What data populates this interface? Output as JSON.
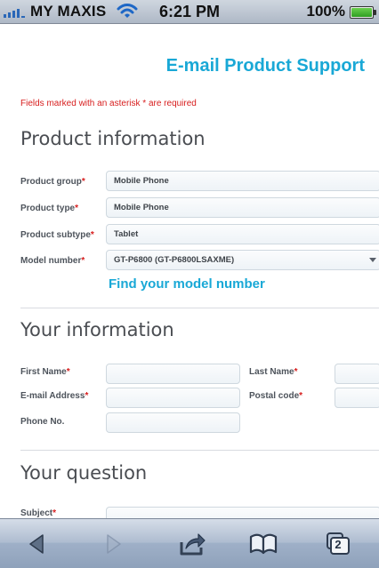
{
  "status_bar": {
    "carrier": "MY MAXIS",
    "time": "6:21 PM",
    "battery": "100%",
    "battery_level": 1.0
  },
  "page": {
    "title": "E-mail Product Support",
    "required_note": "Fields marked with an asterisk * are required"
  },
  "product_section": {
    "heading": "Product information",
    "fields": [
      {
        "label": "Product group",
        "required": true,
        "value": "Mobile Phone"
      },
      {
        "label": "Product type",
        "required": true,
        "value": "Mobile Phone"
      },
      {
        "label": "Product subtype",
        "required": true,
        "value": "Tablet"
      },
      {
        "label": "Model number",
        "required": true,
        "value": "GT-P6800 (GT-P6800LSAXME)"
      }
    ],
    "find_model_link": "Find your model number"
  },
  "your_information": {
    "heading": "Your information",
    "fields": [
      {
        "label": "First Name",
        "required": true,
        "value": ""
      },
      {
        "label": "Last Name",
        "required": true,
        "value": ""
      },
      {
        "label": "E-mail Address",
        "required": true,
        "value": ""
      },
      {
        "label": "Postal code",
        "required": true,
        "value": ""
      },
      {
        "label": "Phone No.",
        "required": false,
        "value": ""
      }
    ]
  },
  "your_question": {
    "heading": "Your question",
    "subject_label": "Subject",
    "subject_required": true
  },
  "toolbar": {
    "tabs_count": "2",
    "icons": [
      "back-icon",
      "forward-icon",
      "share-icon",
      "bookmarks-icon",
      "tabs-icon"
    ]
  },
  "colors": {
    "accent": "#19a8d6",
    "required": "#d71d1d",
    "heading": "#4a4d52"
  }
}
